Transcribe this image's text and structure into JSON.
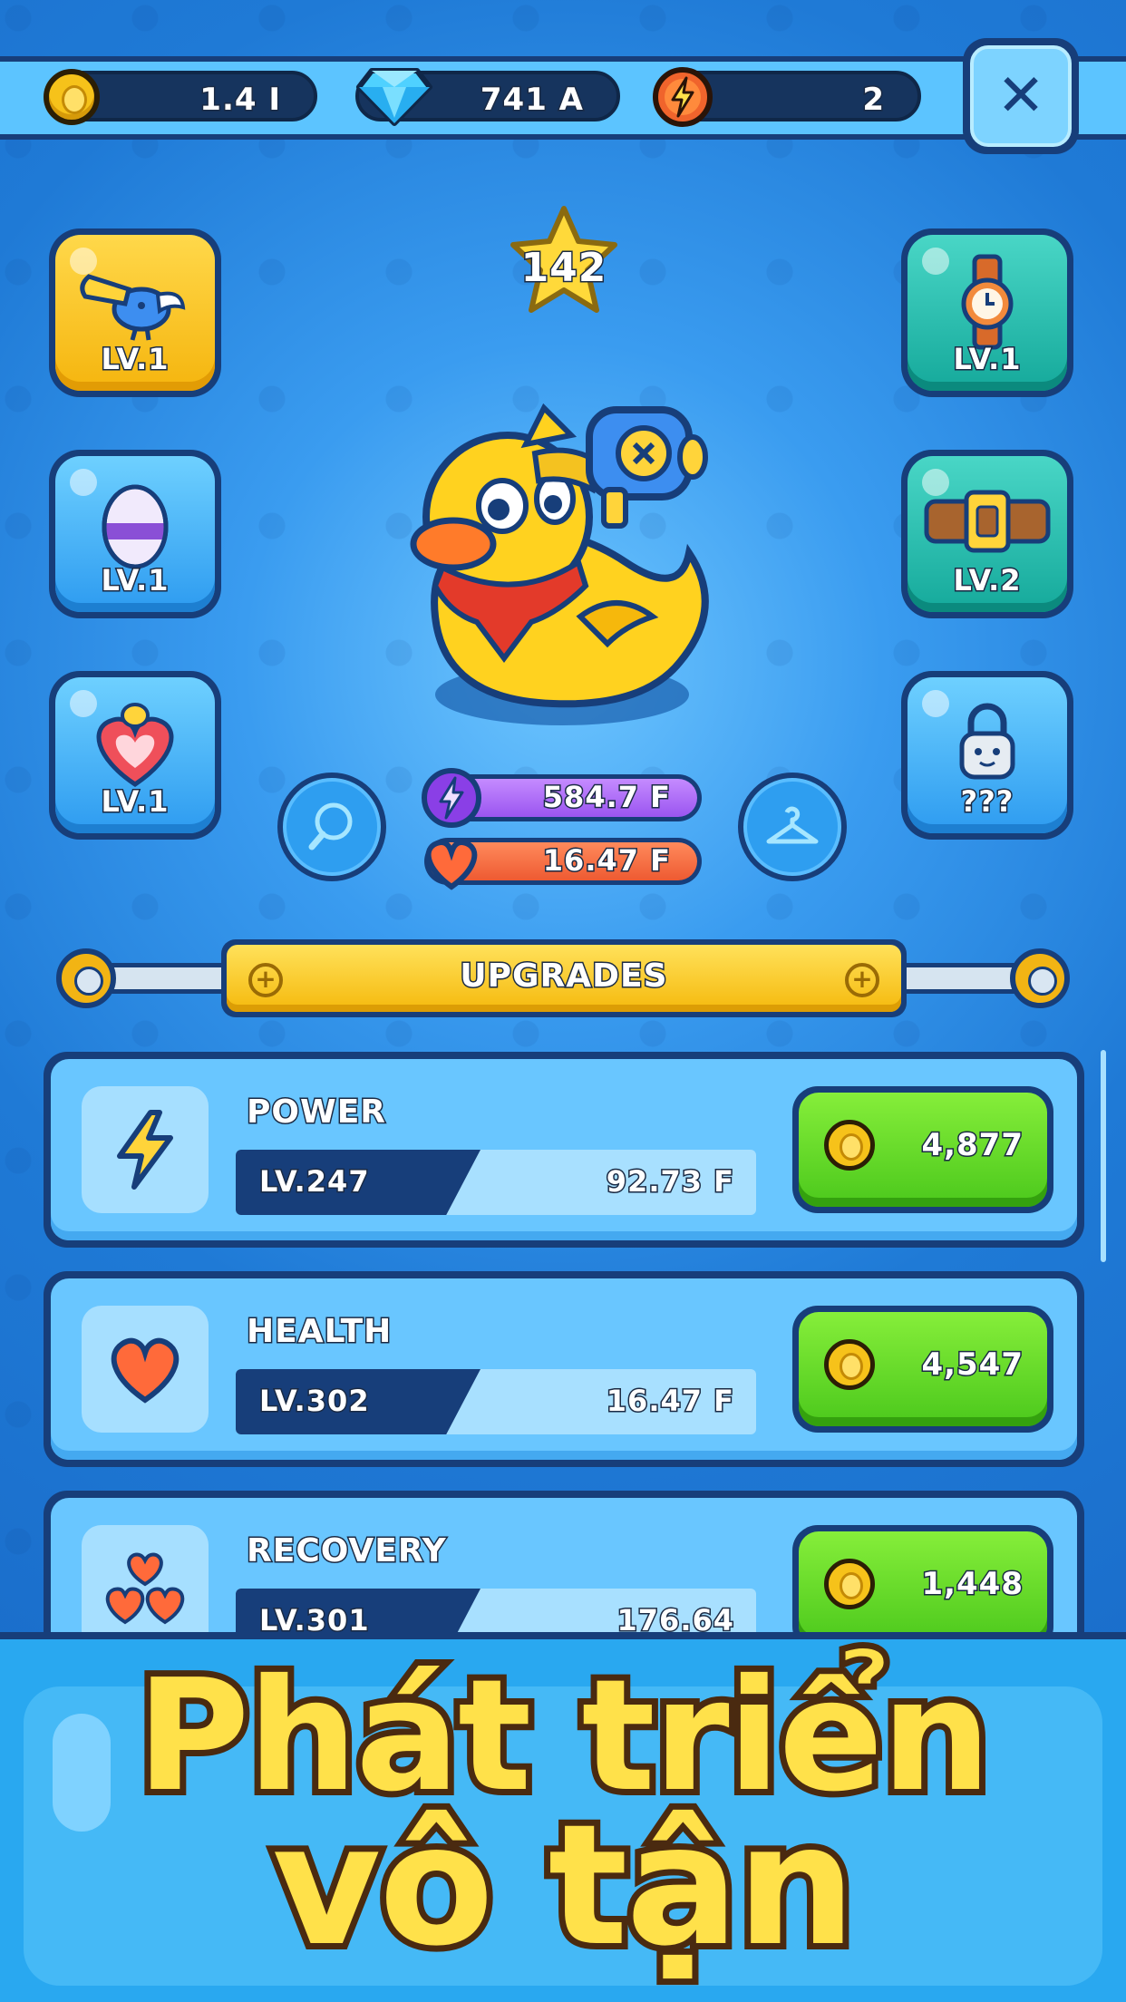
{
  "resources": {
    "coins": "1.4 I",
    "gems": "741 A",
    "energy": "2"
  },
  "close_label": "✕",
  "character": {
    "level": "142",
    "power": "584.7 F",
    "health": "16.47 F"
  },
  "left_slots": [
    {
      "icon": "horn-bird-icon",
      "level": "LV.1"
    },
    {
      "icon": "egg-icon",
      "level": "LV.1"
    },
    {
      "icon": "heart-chick-icon",
      "level": "LV.1"
    }
  ],
  "right_slots": [
    {
      "icon": "watch-icon",
      "level": "LV.1"
    },
    {
      "icon": "belt-icon",
      "level": "LV.2"
    },
    {
      "icon": "lock-icon",
      "level": "???"
    }
  ],
  "section_title": "UPGRADES",
  "upgrades": [
    {
      "name": "POWER",
      "level": "LV.247",
      "value": "92.73 F",
      "cost": "4,877",
      "icon": "lightning-icon"
    },
    {
      "name": "HEALTH",
      "level": "LV.302",
      "value": "16.47 F",
      "cost": "4,547",
      "icon": "heart-icon"
    },
    {
      "name": "RECOVERY",
      "level": "LV.301",
      "value": "176.64",
      "cost": "1,448",
      "icon": "hearts-icon"
    }
  ],
  "promo": {
    "line1": "Phát triển",
    "line2": "vô tận"
  },
  "colors": {
    "background": "#1f7ad6",
    "outline": "#173e7a",
    "gold": "#f6c21a",
    "buy_green": "#4bc81c",
    "headline": "#ffe14a"
  }
}
